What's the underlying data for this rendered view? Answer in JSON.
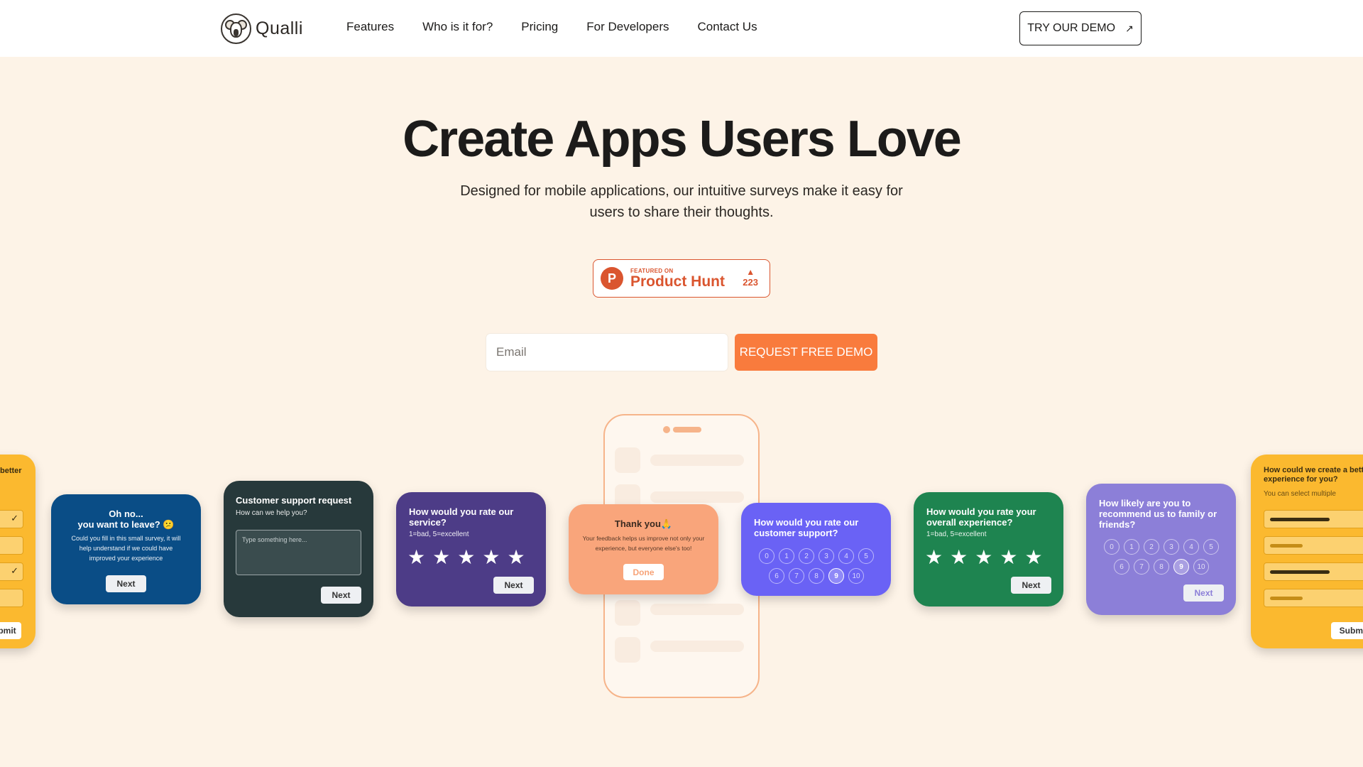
{
  "brand": {
    "name": "Qualli"
  },
  "nav": {
    "items": [
      "Features",
      "Who is it for?",
      "Pricing",
      "For Developers",
      "Contact Us"
    ],
    "cta_label": "TRY OUR DEMO",
    "cta_icon": "arrow-up-right-icon"
  },
  "hero": {
    "title": "Create Apps Users Love",
    "subtitle": "Designed for mobile applications, our intuitive surveys make it easy for users to share their thoughts."
  },
  "product_hunt": {
    "featured": "FEATURED ON",
    "name": "Product Hunt",
    "votes": "223",
    "logo_letter": "P"
  },
  "signup": {
    "email_placeholder": "Email",
    "button_label": "REQUEST FREE DEMO"
  },
  "cards": {
    "left_partial": {
      "title": "better",
      "submit": "bmit"
    },
    "leave": {
      "title": "Oh no...\nyou want to leave? 😕",
      "body": "Could you fill in this small survey, it will help understand if we could have improved your experience",
      "button": "Next"
    },
    "support": {
      "title": "Customer support request",
      "subtitle": "How can we help you?",
      "placeholder": "Type something here...",
      "button": "Next"
    },
    "service": {
      "title": "How would you rate our service?",
      "subtitle": "1=bad, 5=excellent",
      "stars": 5,
      "button": "Next"
    },
    "thanks": {
      "title": "Thank you🙏",
      "body": "Your feedback helps us improve not only your experience, but everyone else's too!",
      "button": "Done"
    },
    "support_rating": {
      "title": "How would you rate our customer support?",
      "options": [
        "0",
        "1",
        "2",
        "3",
        "4",
        "5",
        "6",
        "7",
        "8",
        "9",
        "10"
      ],
      "selected": "9"
    },
    "overall": {
      "title": "How would you rate your overall experience?",
      "subtitle": "1=bad, 5=excellent",
      "stars": 5,
      "button": "Next"
    },
    "recommend": {
      "title": "How likely are you to recommend us to family or friends?",
      "options": [
        "0",
        "1",
        "2",
        "3",
        "4",
        "5",
        "6",
        "7",
        "8",
        "9",
        "10"
      ],
      "selected": "9",
      "button": "Next"
    },
    "right_partial": {
      "title": "How could we create a bette experience for you?",
      "subtitle": "You can select multiple",
      "submit": "Submi"
    }
  },
  "colors": {
    "background": "#fdf3e7",
    "accent": "#f97b3d",
    "product_hunt": "#da552f",
    "card_blue": "#0a4d86",
    "card_dark": "#27393b",
    "card_purple": "#4d3c87",
    "card_orange": "#f9a57b",
    "card_violet": "#6a62f5",
    "card_green": "#1e8450",
    "card_lavender": "#8c7fd8",
    "card_yellow": "#fbb92f"
  }
}
